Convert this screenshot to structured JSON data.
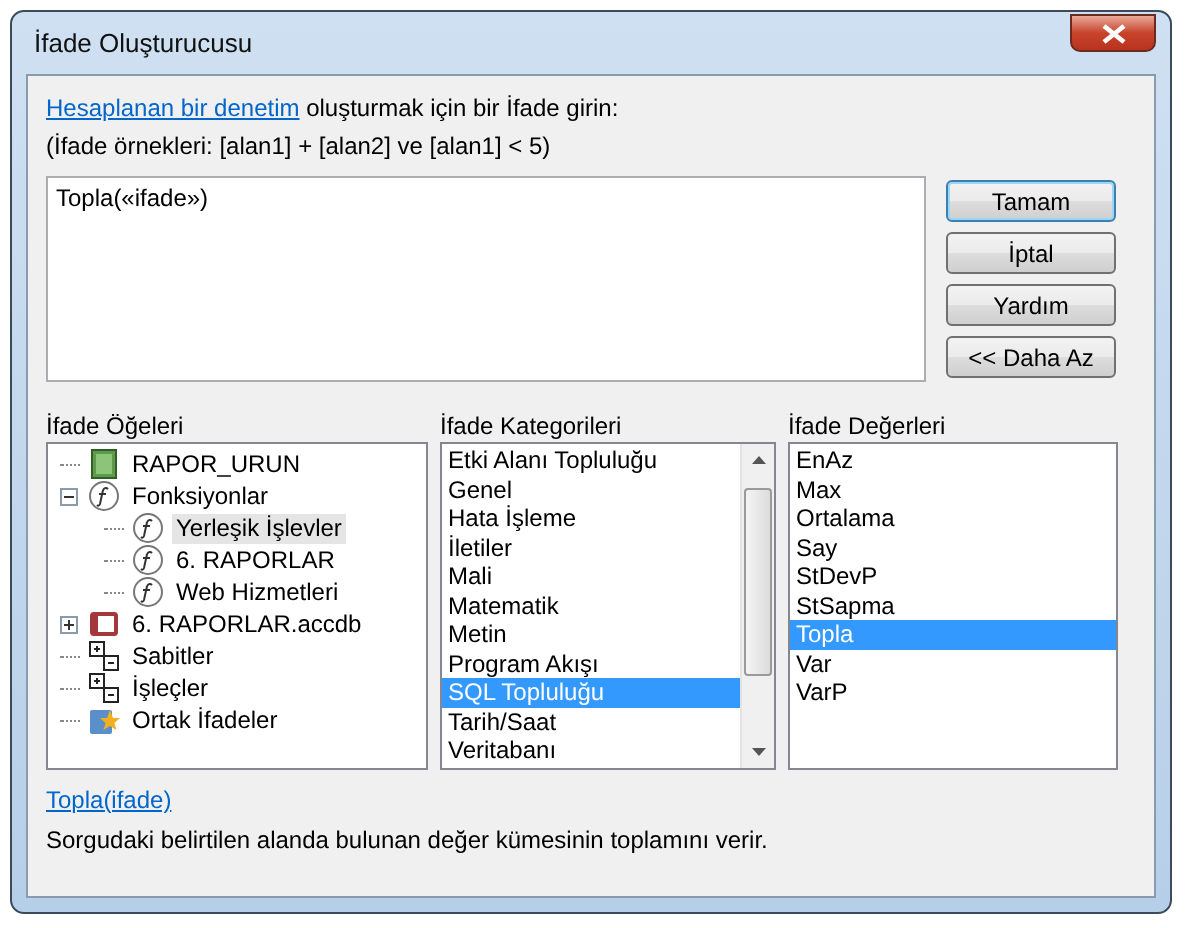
{
  "window": {
    "title": "İfade Oluşturucusu"
  },
  "intro": {
    "link": "Hesaplanan bir denetim",
    "text": " oluşturmak için bir İfade girin:",
    "example": "(İfade örnekleri: [alan1] + [alan2] ve [alan1] < 5)"
  },
  "expression": {
    "value": "Topla(«ifade»)"
  },
  "buttons": [
    {
      "label": "Tamam",
      "default": true
    },
    {
      "label": "İptal",
      "default": false
    },
    {
      "label": "Yardım",
      "default": false
    },
    {
      "label": "<< Daha Az",
      "default": false
    }
  ],
  "elements": {
    "heading": "İfade Öğeleri",
    "items": [
      {
        "label": "RAPOR_URUN",
        "kind": "report",
        "selected": false
      },
      {
        "label": "Fonksiyonlar",
        "kind": "function",
        "selected": false,
        "expanded": true,
        "children": [
          {
            "label": "Yerleşik İşlevler",
            "kind": "function",
            "selected": true
          },
          {
            "label": "6. RAPORLAR",
            "kind": "function",
            "selected": false
          },
          {
            "label": "Web Hizmetleri",
            "kind": "function",
            "selected": false
          }
        ]
      },
      {
        "label": "6. RAPORLAR.accdb",
        "kind": "database",
        "selected": false,
        "expanded": false
      },
      {
        "label": "Sabitler",
        "kind": "operators",
        "selected": false
      },
      {
        "label": "İşleçler",
        "kind": "operators",
        "selected": false
      },
      {
        "label": "Ortak İfadeler",
        "kind": "common",
        "selected": false
      }
    ]
  },
  "categories": {
    "heading": "İfade Kategorileri",
    "items": [
      {
        "label": "Etki Alanı Topluluğu",
        "selected": false
      },
      {
        "label": "Genel",
        "selected": false
      },
      {
        "label": "Hata İşleme",
        "selected": false
      },
      {
        "label": "İletiler",
        "selected": false
      },
      {
        "label": "Mali",
        "selected": false
      },
      {
        "label": "Matematik",
        "selected": false
      },
      {
        "label": "Metin",
        "selected": false
      },
      {
        "label": "Program Akışı",
        "selected": false
      },
      {
        "label": "SQL Topluluğu",
        "selected": true
      },
      {
        "label": "Tarih/Saat",
        "selected": false
      },
      {
        "label": "Veritabanı",
        "selected": false
      }
    ]
  },
  "values": {
    "heading": "İfade Değerleri",
    "items": [
      {
        "label": "EnAz",
        "selected": false
      },
      {
        "label": "Max",
        "selected": false
      },
      {
        "label": "Ortalama",
        "selected": false
      },
      {
        "label": "Say",
        "selected": false
      },
      {
        "label": "StDevP",
        "selected": false
      },
      {
        "label": "StSapma",
        "selected": false
      },
      {
        "label": "Topla",
        "selected": true
      },
      {
        "label": "Var",
        "selected": false
      },
      {
        "label": "VarP",
        "selected": false
      }
    ]
  },
  "help": {
    "syntax": "Topla(ifade)",
    "description": "Sorgudaki belirtilen alanda bulunan değer kümesinin toplamını verir."
  }
}
